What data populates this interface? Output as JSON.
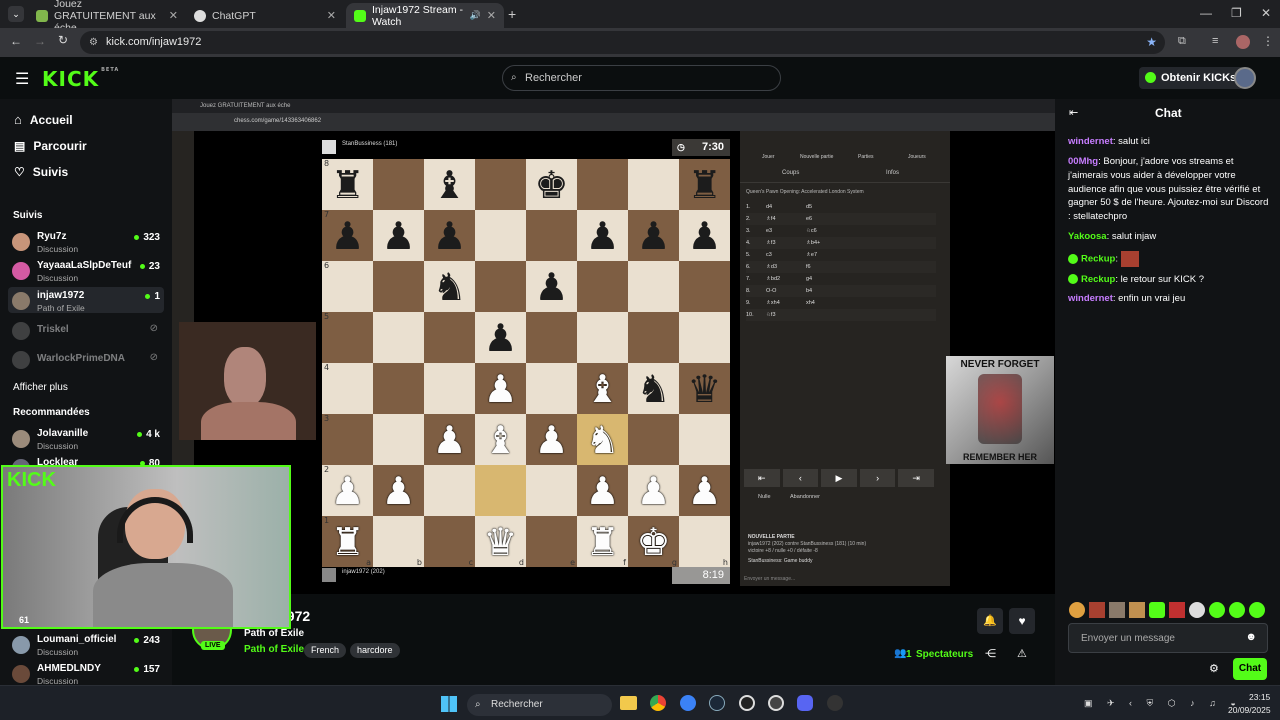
{
  "browser": {
    "tabs": [
      {
        "label": "Jouez GRATUITEMENT aux éche"
      },
      {
        "label": "ChatGPT"
      },
      {
        "label": "Injaw1972 Stream - Watch"
      }
    ],
    "url": "kick.com/injaw1972"
  },
  "header": {
    "logo": "KICK",
    "logo_badge": "BETA",
    "search_placeholder": "Rechercher",
    "kicks_button": "Obtenir KICKs"
  },
  "sidebar": {
    "nav": [
      {
        "label": "Accueil"
      },
      {
        "label": "Parcourir"
      },
      {
        "label": "Suivis"
      }
    ],
    "followed_title": "Suivis",
    "followed": [
      {
        "name": "Ryu7z",
        "category": "Discussion",
        "count": "323"
      },
      {
        "name": "YayaaaLaSlpDeTeuf",
        "category": "Discussion",
        "count": "23"
      },
      {
        "name": "injaw1972",
        "category": "Path of Exile",
        "count": "1"
      },
      {
        "name": "Triskel",
        "category": "",
        "count": ""
      },
      {
        "name": "WarlockPrimeDNA",
        "category": "",
        "count": ""
      }
    ],
    "show_more": "Afficher plus",
    "recommended_title": "Recommandées",
    "recommended": [
      {
        "name": "Jolavanille",
        "category": "Discussion",
        "count": "4 k"
      },
      {
        "name": "Locklear",
        "category": "",
        "count": "80"
      },
      {
        "name": "Loumani_officiel",
        "category": "Discussion",
        "count": "243"
      },
      {
        "name": "AHMEDLNDY",
        "category": "Discussion",
        "count": "157"
      }
    ]
  },
  "video": {
    "inner_tab": "Jouez GRATUITEMENT aux éche",
    "inner_url": "chess.com/game/143363406862",
    "opponent": "StanBussiness (181)",
    "player": "injaw1972 (202)",
    "clock_top": "7:30",
    "clock_bottom": "8:19",
    "panel_tabs": [
      "Jouer",
      "Nouvelle partie",
      "Parties",
      "Joueurs"
    ],
    "sub_tabs": [
      "Coups",
      "Infos"
    ],
    "opening": "Queen's Pawn Opening: Accelerated London System",
    "moves": [
      {
        "n": "1.",
        "w": "d4",
        "b": "d5"
      },
      {
        "n": "2.",
        "w": "♗f4",
        "b": "e6"
      },
      {
        "n": "3.",
        "w": "e3",
        "b": "♘c6"
      },
      {
        "n": "4.",
        "w": "♗f3",
        "b": "♗b4+"
      },
      {
        "n": "5.",
        "w": "c3",
        "b": "♗e7"
      },
      {
        "n": "6.",
        "w": "♗d3",
        "b": "f6"
      },
      {
        "n": "7.",
        "w": "♗bd2",
        "b": "g4"
      },
      {
        "n": "8.",
        "w": "O-O",
        "b": "b4"
      },
      {
        "n": "9.",
        "w": "♗xh4",
        "b": "xh4"
      },
      {
        "n": "10.",
        "w": "♘f3",
        "b": ""
      }
    ],
    "draw": "Nulle",
    "resign": "Abandonner",
    "new_game_title": "NOUVELLE PARTIE",
    "new_game_text": "injaw1972 (202) contre StanBussiness (181) (10 min)",
    "new_game_sub": "victoire +8 / nulle +0 / défaite -8",
    "game_chat": "StanBussiness: Game buddy",
    "message_placeholder": "Envoyer un message...",
    "poster_top": "NEVER FORGET",
    "poster_bottom": "REMEMBER HER",
    "cam_badge": "KICK",
    "cam_count": "61"
  },
  "channel": {
    "name": "injaw1972",
    "game": "Path of Exile",
    "category": "Path of Exile",
    "tags": [
      "French",
      "harcdore"
    ],
    "live": "LIVE",
    "spectators_count": "1",
    "spectators_label": "Spectateurs"
  },
  "chat": {
    "title": "Chat",
    "messages": [
      {
        "user": "windernet",
        "color": "#c77dff",
        "text": "salut ici"
      },
      {
        "user": "00Mhg",
        "color": "#c77dff",
        "text": "Bonjour, j'adore vos streams et j'aimerais vous aider à développer votre audience afin que vous puissiez être vérifié et gagner 50 $ de l'heure. Ajoutez-moi sur Discord : stellatechpro"
      },
      {
        "user": "Yakoosa",
        "color": "#53fc18",
        "text": "salut injaw"
      },
      {
        "user": "Reckup",
        "color": "#53fc18",
        "text": ""
      },
      {
        "user": "Reckup",
        "color": "#53fc18",
        "text": "le retour sur KICK ?"
      },
      {
        "user": "windernet",
        "color": "#c77dff",
        "text": "enfin un vrai jeu"
      }
    ],
    "input_placeholder": "Envoyer un message",
    "send_button": "Chat"
  },
  "taskbar": {
    "search": "Rechercher",
    "time": "23:15",
    "date": "20/09/2025"
  },
  "colors": {
    "brand": "#53fc18",
    "background": "#0b0e0f",
    "panel": "#111315"
  }
}
